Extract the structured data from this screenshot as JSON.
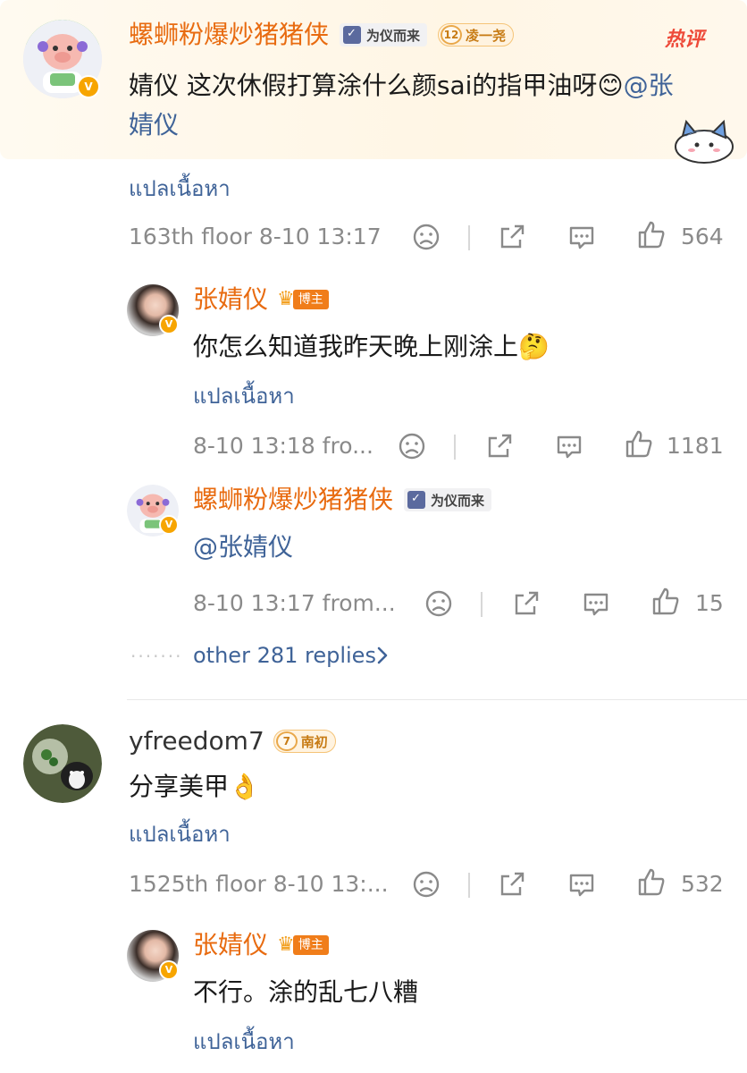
{
  "comment1": {
    "username": "螺蛳粉爆炒猪猪侠",
    "tag_fan": "为仪而来",
    "level_num": "12",
    "level_name": "凌一尧",
    "hot_label": "热评",
    "text": "婧仪 这次休假打算涂什么颜sai的指甲油呀😊",
    "mention_a": "@张",
    "mention_b": "婧仪",
    "translate": "แปลเนื้อหา",
    "meta": "163th floor 8-10 13:17",
    "likes": "564"
  },
  "reply1": {
    "username": "张婧仪",
    "badge": "博主",
    "text": "你怎么知道我昨天晚上刚涂上🤔",
    "translate": "แปลเนื้อหา",
    "meta": "8-10 13:18  fro...",
    "likes": "1181"
  },
  "reply2": {
    "username": "螺蛳粉爆炒猪猪侠",
    "tag_fan": "为仪而来",
    "text": "@张婧仪",
    "meta": "8-10 13:17  from...",
    "likes": "15"
  },
  "more_replies": "other 281 replies",
  "comment2": {
    "username": "yfreedom7",
    "level_num": "7",
    "level_name": "南初",
    "text": "分享美甲👌",
    "translate": "แปลเนื้อหา",
    "meta": "1525th floor 8-10 13:...",
    "likes": "532"
  },
  "reply3": {
    "username": "张婧仪",
    "badge": "博主",
    "text": "不行。涂的乱七八糟",
    "translate": "แปลเนื้อหา"
  },
  "colors": {
    "username_accent": "#e86b10",
    "link_blue": "#3f6398",
    "meta_gray": "#8a8a8a",
    "hot_red": "#ee4b3a"
  },
  "icons": [
    "dislike-icon",
    "share-icon",
    "comment-icon",
    "like-icon",
    "chevron-right-icon",
    "verified-icon",
    "crown-icon"
  ]
}
